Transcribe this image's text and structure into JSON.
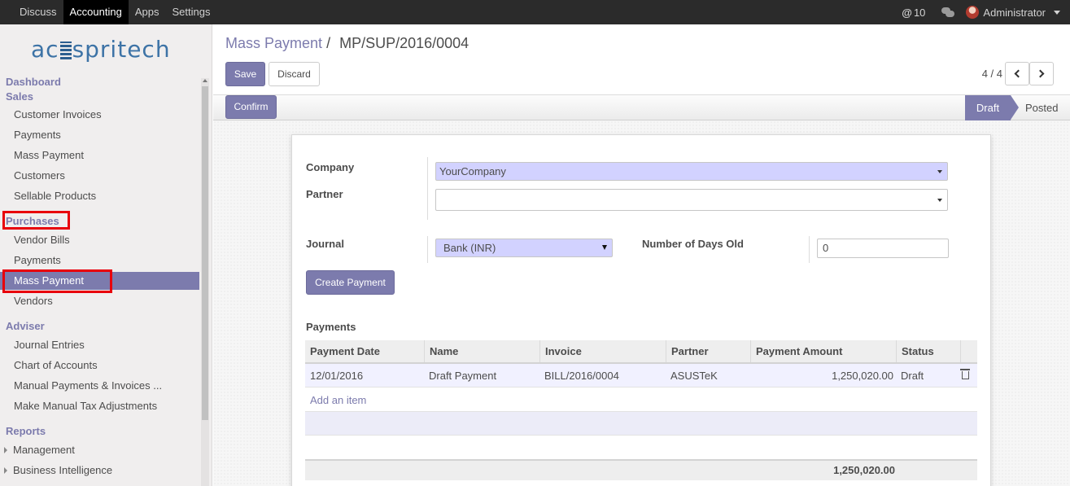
{
  "topbar": {
    "menu": [
      "Discuss",
      "Accounting",
      "Apps",
      "Settings"
    ],
    "active_menu": "Accounting",
    "mentions_count": "10",
    "user": "Administrator"
  },
  "sidebar": {
    "logo_text_left": "ac",
    "logo_text_right": "spritech",
    "dashboard": "Dashboard",
    "sales_head": "Sales",
    "sales_items": [
      "Customer Invoices",
      "Payments",
      "Mass Payment",
      "Customers",
      "Sellable Products"
    ],
    "purchases_head": "Purchases",
    "purchases_items": [
      "Vendor Bills",
      "Payments",
      "Mass Payment",
      "Vendors"
    ],
    "adviser_head": "Adviser",
    "adviser_items": [
      "Journal Entries",
      "Chart of Accounts",
      "Manual Payments & Invoices ...",
      "Make Manual Tax Adjustments"
    ],
    "reports_head": "Reports",
    "reports_items": [
      "Management",
      "Business Intelligence"
    ]
  },
  "breadcrumb": {
    "parent": "Mass Payment",
    "separator": "/",
    "current": "MP/SUP/2016/0004"
  },
  "buttons": {
    "save": "Save",
    "discard": "Discard",
    "confirm": "Confirm",
    "create_payment": "Create Payment"
  },
  "pager": {
    "text": "4 / 4"
  },
  "status_stages": {
    "draft": "Draft",
    "posted": "Posted",
    "active": "Draft"
  },
  "form": {
    "company_label": "Company",
    "company_value": "YourCompany",
    "partner_label": "Partner",
    "partner_value": "",
    "journal_label": "Journal",
    "journal_value": "Bank (INR)",
    "days_label": "Number of Days Old",
    "days_value": "0"
  },
  "payments": {
    "title": "Payments",
    "columns": [
      "Payment Date",
      "Name",
      "Invoice",
      "Partner",
      "Payment Amount",
      "Status"
    ],
    "rows": [
      {
        "date": "12/01/2016",
        "name": "Draft Payment",
        "invoice": "BILL/2016/0004",
        "partner": "ASUSTeK",
        "amount": "1,250,020.00",
        "status": "Draft"
      }
    ],
    "add_item": "Add an item",
    "total": "1,250,020.00"
  },
  "colors": {
    "accent": "#7c7bad",
    "highlight": "#e8000b",
    "topbar": "#2b2b2b"
  }
}
